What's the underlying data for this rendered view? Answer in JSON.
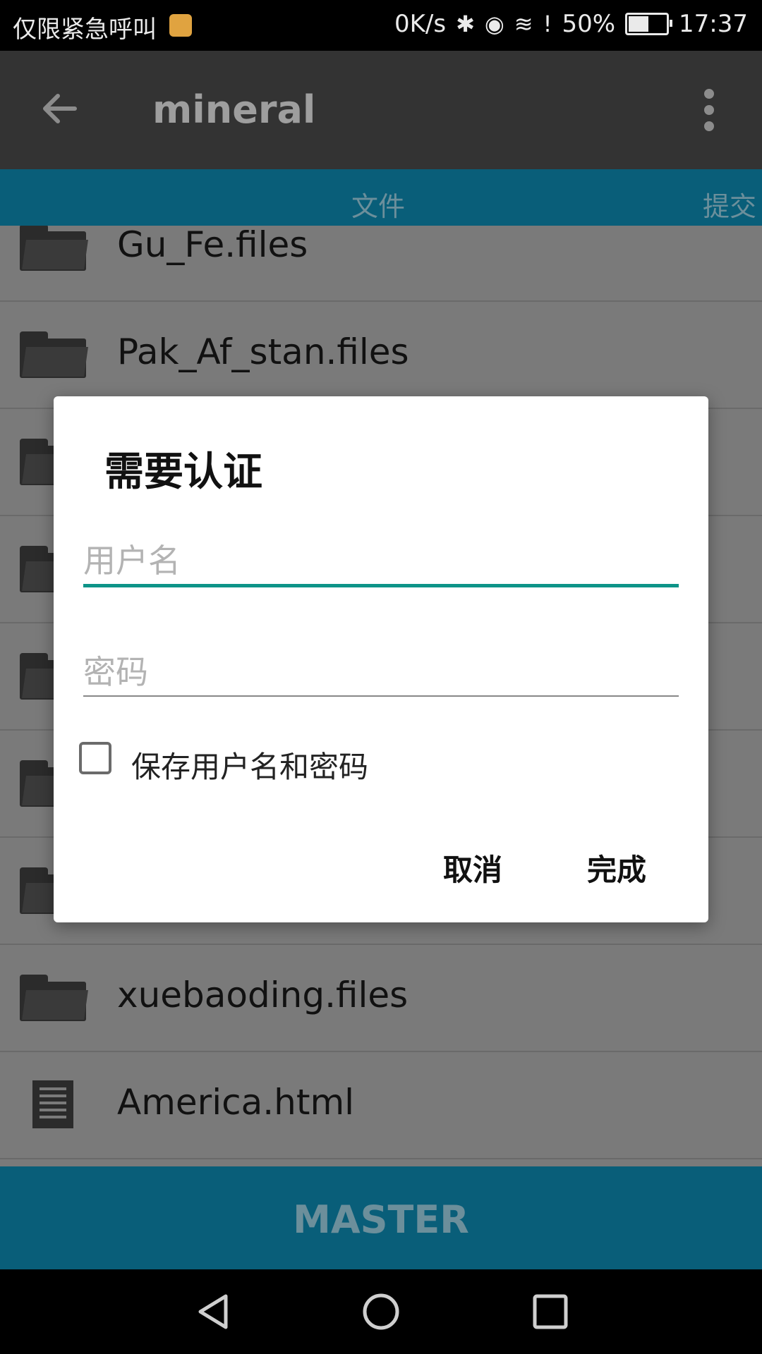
{
  "status_bar": {
    "left_text": "仅限紧急呼叫",
    "speed": "0K/s",
    "battery": "50%",
    "time": "17:37"
  },
  "app_bar": {
    "title": "mineral"
  },
  "tabs": [
    {
      "label": "文件"
    },
    {
      "label": "提交"
    }
  ],
  "files": [
    {
      "name": "Gu_Fe.files",
      "type": "folder"
    },
    {
      "name": "Pak_Af_stan.files",
      "type": "folder"
    },
    {
      "name": "",
      "type": "folder"
    },
    {
      "name": "",
      "type": "folder"
    },
    {
      "name": "",
      "type": "folder"
    },
    {
      "name": "",
      "type": "folder"
    },
    {
      "name": "",
      "type": "folder"
    },
    {
      "name": "xuebaoding.files",
      "type": "folder"
    },
    {
      "name": "America.html",
      "type": "file"
    }
  ],
  "branch_bar": {
    "label": "MASTER"
  },
  "dialog": {
    "title": "需要认证",
    "username_placeholder": "用户名",
    "password_placeholder": "密码",
    "save_label": "保存用户名和密码",
    "cancel_label": "取消",
    "done_label": "完成"
  },
  "colors": {
    "accent": "#0d9488",
    "primary": "#095e79"
  }
}
